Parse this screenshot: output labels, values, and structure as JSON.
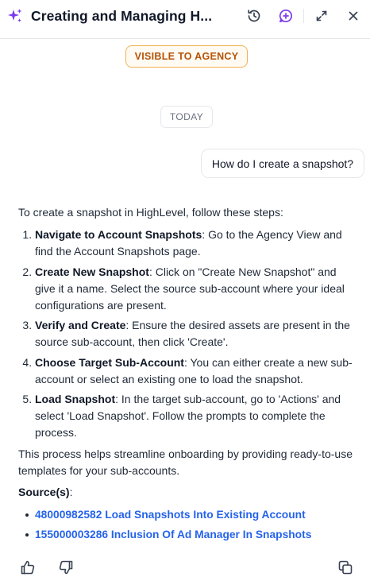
{
  "header": {
    "title": "Creating and Managing H...",
    "icons": [
      "sparkle-icon",
      "history-icon",
      "new-chat-icon",
      "expand-icon",
      "close-icon"
    ],
    "accent_color": "#7c3aed"
  },
  "visibility_badge": "VISIBLE TO AGENCY",
  "date_divider": "TODAY",
  "user_message": "How do I create a snapshot?",
  "answer": {
    "intro": "To create a snapshot in HighLevel, follow these steps:",
    "steps": [
      {
        "title": "Navigate to Account Snapshots",
        "text": ": Go to the Agency View and find the Account Snapshots page."
      },
      {
        "title": "Create New Snapshot",
        "text": ": Click on \"Create New Snapshot\" and give it a name. Select the source sub-account where your ideal configurations are present."
      },
      {
        "title": "Verify and Create",
        "text": ": Ensure the desired assets are present in the source sub-account, then click 'Create'."
      },
      {
        "title": "Choose Target Sub-Account",
        "text": ": You can either create a new sub-account or select an existing one to load the snapshot."
      },
      {
        "title": "Load Snapshot",
        "text": ": In the target sub-account, go to 'Actions' and select 'Load Snapshot'. Follow the prompts to complete the process."
      }
    ],
    "outro": "This process helps streamline onboarding by providing ready-to-use templates for your sub-accounts.",
    "sources_label": "Source(s)",
    "sources_colon": ":",
    "sources": [
      "48000982582 Load Snapshots Into Existing Account",
      "155000003286 Inclusion Of Ad Manager In Snapshots"
    ]
  },
  "footer": {
    "icons": [
      "thumbs-up-icon",
      "thumbs-down-icon",
      "copy-icon"
    ]
  }
}
